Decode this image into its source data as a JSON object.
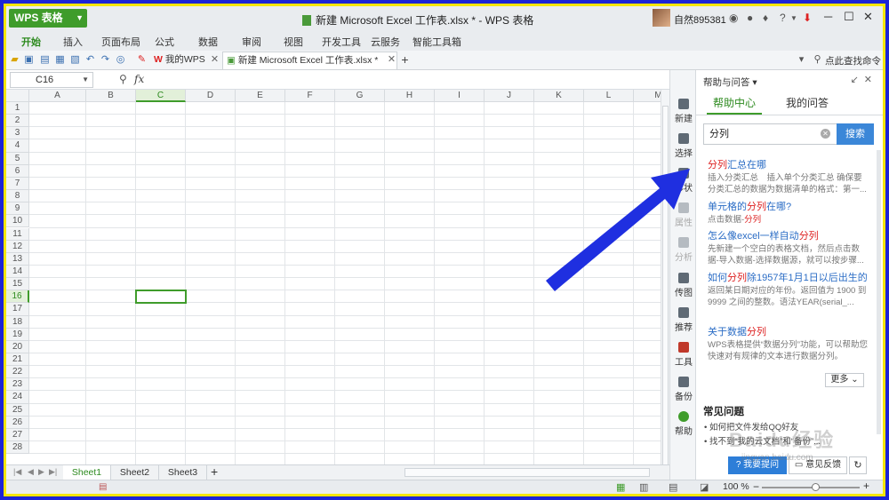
{
  "app": {
    "name": "WPS 表格",
    "doc_title": "新建 Microsoft Excel 工作表.xlsx * - WPS 表格",
    "username": "自然895381"
  },
  "menu_tabs": [
    "开始",
    "插入",
    "页面布局",
    "公式",
    "数据",
    "审阅",
    "视图",
    "开发工具",
    "云服务",
    "智能工具箱"
  ],
  "doc_tabs": [
    {
      "label": "我的WPS",
      "logo": "W"
    },
    {
      "label": "新建 Microsoft Excel 工作表.xlsx *"
    }
  ],
  "search_command": "点此查找命令",
  "formula_bar": {
    "name_box": "C16",
    "fx": "fx"
  },
  "columns": [
    "A",
    "B",
    "C",
    "D",
    "E",
    "F",
    "G",
    "H",
    "I",
    "J",
    "K",
    "L",
    "M"
  ],
  "rows": [
    "1",
    "2",
    "3",
    "4",
    "5",
    "6",
    "7",
    "8",
    "9",
    "10",
    "11",
    "12",
    "13",
    "14",
    "15",
    "16",
    "17",
    "18",
    "19",
    "20",
    "21",
    "22",
    "23",
    "24",
    "25",
    "26",
    "27",
    "28"
  ],
  "selected_cell": {
    "col": "C",
    "row": "16"
  },
  "sheets": [
    "Sheet1",
    "Sheet2",
    "Sheet3"
  ],
  "add_sheet": "+",
  "status": {
    "zoom": "100 %"
  },
  "rail": {
    "items": [
      {
        "label": "新建",
        "icon": "new-doc-icon"
      },
      {
        "label": "选择",
        "icon": "select-icon"
      },
      {
        "label": "形状",
        "icon": "shape-icon"
      },
      {
        "label": "属性",
        "icon": "property-icon"
      },
      {
        "label": "分析",
        "icon": "analyze-icon"
      },
      {
        "label": "传图",
        "icon": "upload-image-icon"
      },
      {
        "label": "推荐",
        "icon": "recommend-icon"
      },
      {
        "label": "工具",
        "icon": "toolbox-icon"
      },
      {
        "label": "备份",
        "icon": "backup-icon"
      },
      {
        "label": "帮助",
        "icon": "help-icon"
      }
    ]
  },
  "help": {
    "title": "帮助与问答 ▾",
    "tabs": [
      "帮助中心",
      "我的问答"
    ],
    "search_value": "分列",
    "search_button": "搜索",
    "results": [
      {
        "title_hl": "分列",
        "title_rest": "汇总在哪",
        "desc": "插入分类汇总　插入单个分类汇总 确保要分类汇总的数据为数据清单的格式：第一..."
      },
      {
        "title_pre": "单元格的",
        "title_hl": "分列",
        "title_rest": "在哪?",
        "desc_pre": "点击数据-",
        "desc_hl": "分列"
      },
      {
        "title_pre": "怎么像excel一样自动",
        "title_hl": "分列",
        "title_rest": "",
        "desc": "先新建一个空白的表格文档，然后点击数据-导入数据-选择数据源，就可以按步骤..."
      },
      {
        "title_pre": "如何",
        "title_hl": "分列",
        "title_rest": "除1957年1月1日以后出生的",
        "desc": "返回某日期对应的年份。返回值为 1900 到 9999 之间的整数。语法YEAR(serial_..."
      },
      {
        "title_pre": "关于数据",
        "title_hl": "分列",
        "title_rest": "",
        "desc": "WPS表格提供“数据分列”功能，可以帮助您快速对有规律的文本进行数据分列。"
      }
    ],
    "more": "更多",
    "faq_title": "常见问题",
    "faq": [
      "如何把文件发给QQ好友",
      "找不到“我的云文档”和“备份”..."
    ],
    "ask_button": "我要提问",
    "feedback_button": "意见反馈"
  },
  "watermark": {
    "text": "Baidu经验",
    "url": "jingyan.baidu.com"
  },
  "colors": {
    "accent": "#3f9c2b",
    "frame": "#1c24d6",
    "frame_outline": "#f5e600",
    "link": "#2a6cc5",
    "highlight": "#dd2222",
    "arrow": "#1f2fe0"
  }
}
